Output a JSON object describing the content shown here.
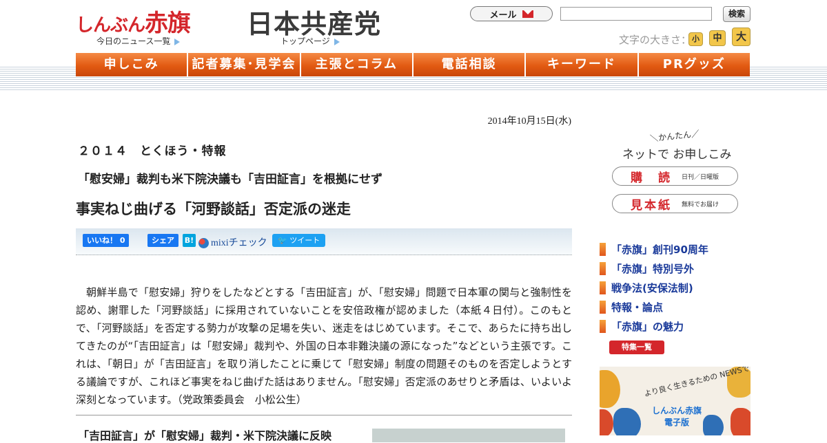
{
  "header": {
    "logo_akahata": "しんぶん赤旗",
    "logo_akahata_lead": "しんぶん",
    "logo_akahata_main": "赤旗",
    "news_list_link": "今日のニュース一覧",
    "logo_jcp": "日本共産党",
    "top_page_link": "トップページ",
    "mail_label": "メール",
    "search_value": "",
    "search_button": "検索",
    "font_size_label": "文字の大きさ：",
    "font_sizes": [
      "小",
      "中",
      "大"
    ]
  },
  "nav": {
    "items": [
      "申しこみ",
      "記者募集･見学会",
      "主張とコラム",
      "電話相談",
      "キーワード",
      "PRグッズ"
    ]
  },
  "article": {
    "date": "2014年10月15日(水)",
    "series": "２０１４　とくほう・特報",
    "subtitle": "「慰安婦」裁判も米下院決議も「吉田証言」を根拠にせず",
    "title": "事実ねじ曲げる「河野談話」否定派の迷走",
    "social": {
      "like": "いいね！ 0",
      "share": "シェア",
      "hatena": "B!",
      "mixi": "mixiチェック",
      "tweet": "ツイート"
    },
    "body": "朝鮮半島で「慰安婦」狩りをしたなどとする「吉田証言」が、「慰安婦」問題で日本軍の関与と強制性を認め、謝罪した「河野談話」に採用されていないことを安倍政権が認めました（本紙４日付）。このもとで、「河野談話」を否定する勢力が攻撃の足場を失い、迷走をはじめています。そこで、あらたに持ち出してきたのが“「吉田証言」は「慰安婦」裁判や、外国の日本非難決議の源になった”などという主張です。これは、「朝日」が「吉田証言」を取り消したことに乗じて「慰安婦」制度の問題そのものを否定しようとする議論ですが、これほど事実をねじ曲げた話はありません。「慰安婦」否定派のあせりと矛盾は、いよいよ深刻となっています。（党政策委員会　小松公生）",
    "next_heading": "「吉田証言」が「慰安婦」裁判・米下院決議に反映"
  },
  "sidebar": {
    "kantan": "かんたん",
    "net_apply": "ネットで お申しこみ",
    "subscribe": {
      "label": "購　読",
      "note": "日刊／日曜版"
    },
    "sample": {
      "label": "見本紙",
      "note": "無料でお届け"
    },
    "links": [
      "「赤旗」創刊90周年",
      "「赤旗」特別号外",
      "戦争法(安保法制)",
      "特報・論点",
      "「赤旗」の魅力"
    ],
    "tokushu_button": "特集一覧",
    "banner_tagline": "より良く生きるための NEWSです。",
    "banner_title_1": "しんぶん赤旗",
    "banner_title_2": "電子版"
  },
  "colors": {
    "brand_red": "#d4262b",
    "nav_orange": "#e25a12",
    "link_blue": "#1a3a9a"
  }
}
